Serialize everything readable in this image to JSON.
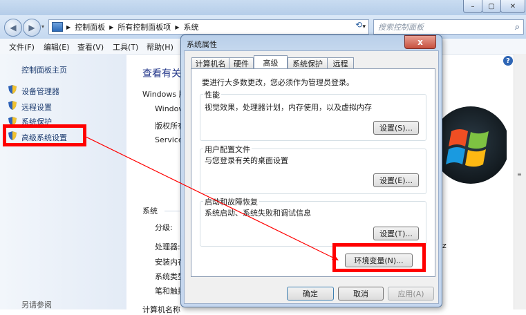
{
  "window": {
    "caption_buttons": [
      "–",
      "▢",
      "✕"
    ]
  },
  "address_bar": {
    "crumbs": [
      "控制面板",
      "所有控制面板项",
      "系统"
    ],
    "search_placeholder": "搜索控制面板"
  },
  "menu": [
    "文件(F)",
    "编辑(E)",
    "查看(V)",
    "工具(T)",
    "帮助(H)"
  ],
  "left_pane": {
    "home": "控制面板主页",
    "links": [
      "设备管理器",
      "远程设置",
      "系统保护",
      "高级系统设置"
    ],
    "see_also": "另请参阅"
  },
  "main": {
    "heading": "查看有关",
    "windows_label": "Windows 版",
    "edition": "Window",
    "copyright": "版权所有",
    "service": "Service",
    "system_header": "系统",
    "rows": [
      "分级:",
      "处理器:",
      "安装内存",
      "系统类型",
      "笔和触摸"
    ],
    "right_fragment": "z",
    "bottom_fragment": "计算机名称"
  },
  "dialog": {
    "title": "系统属性",
    "close": "x",
    "tabs": [
      "计算机名",
      "硬件",
      "高级",
      "系统保护",
      "远程"
    ],
    "active_tab": "高级",
    "admin_note": "要进行大多数更改，您必须作为管理员登录。",
    "perf": {
      "label": "性能",
      "desc": "视觉效果，处理器计划，内存使用，以及虚拟内存",
      "button": "设置(S)..."
    },
    "profile": {
      "label": "用户配置文件",
      "desc": "与您登录有关的桌面设置",
      "button": "设置(E)..."
    },
    "startup": {
      "label": "启动和故障恢复",
      "desc": "系统启动、系统失败和调试信息",
      "button": "设置(T)..."
    },
    "env_button": "环境变量(N)...",
    "ok": "确定",
    "cancel": "取消",
    "apply": "应用(A)"
  },
  "colors": {
    "highlight": "#ff0000",
    "link": "#1b3a6e",
    "heading": "#1e3287"
  }
}
